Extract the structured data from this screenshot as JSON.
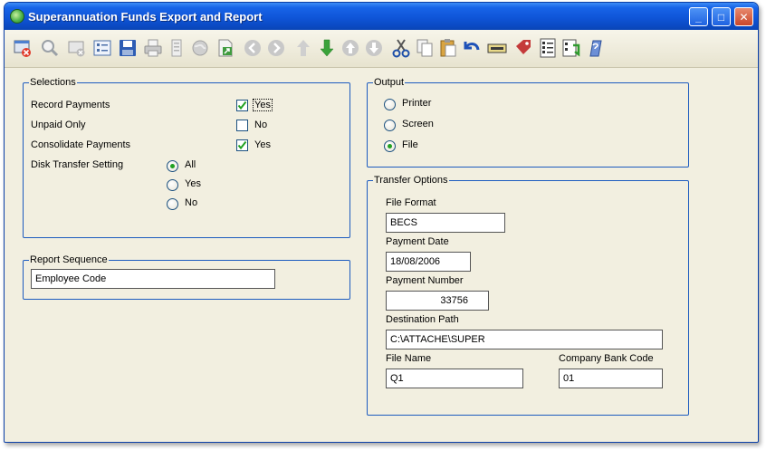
{
  "window": {
    "title": "Superannuation Funds Export and Report",
    "buttons": {
      "minimize": "_",
      "maximize": "□",
      "close": "✕"
    }
  },
  "toolbar": [
    "close-form",
    "search",
    "delete",
    "details",
    "save",
    "print",
    "preview",
    "globe",
    "export",
    "previous",
    "next",
    "move-up",
    "move-down",
    "first",
    "last",
    "cut",
    "copy",
    "paste",
    "undo",
    "keyboard",
    "tag",
    "list",
    "refresh",
    "help"
  ],
  "selections": {
    "title": "Selections",
    "record_payments": {
      "label": "Record Payments",
      "value": "Yes",
      "checked": true
    },
    "unpaid_only": {
      "label": "Unpaid Only",
      "value": "No",
      "checked": false
    },
    "consolidate_payments": {
      "label": "Consolidate Payments",
      "value": "Yes",
      "checked": true
    },
    "disk_transfer": {
      "label": "Disk Transfer Setting",
      "options": [
        "All",
        "Yes",
        "No"
      ],
      "selected": "All"
    }
  },
  "report_sequence": {
    "title": "Report Sequence",
    "value": "Employee Code"
  },
  "output": {
    "title": "Output",
    "options": [
      "Printer",
      "Screen",
      "File"
    ],
    "selected": "File"
  },
  "transfer_options": {
    "title": "Transfer Options",
    "file_format": {
      "label": "File Format",
      "value": "BECS"
    },
    "payment_date": {
      "label": "Payment Date",
      "value": "18/08/2006"
    },
    "payment_number": {
      "label": "Payment Number",
      "value": "33756"
    },
    "destination_path": {
      "label": "Destination Path",
      "value": "C:\\ATTACHE\\SUPER"
    },
    "file_name": {
      "label": "File Name",
      "value": "Q1"
    },
    "company_bank_code": {
      "label": "Company Bank Code",
      "value": "01"
    }
  },
  "colors": {
    "titlebar": "#0f55d8",
    "window_bg": "#f2efe0",
    "group_border": "#1d5bbf",
    "check_green": "#21a121"
  }
}
